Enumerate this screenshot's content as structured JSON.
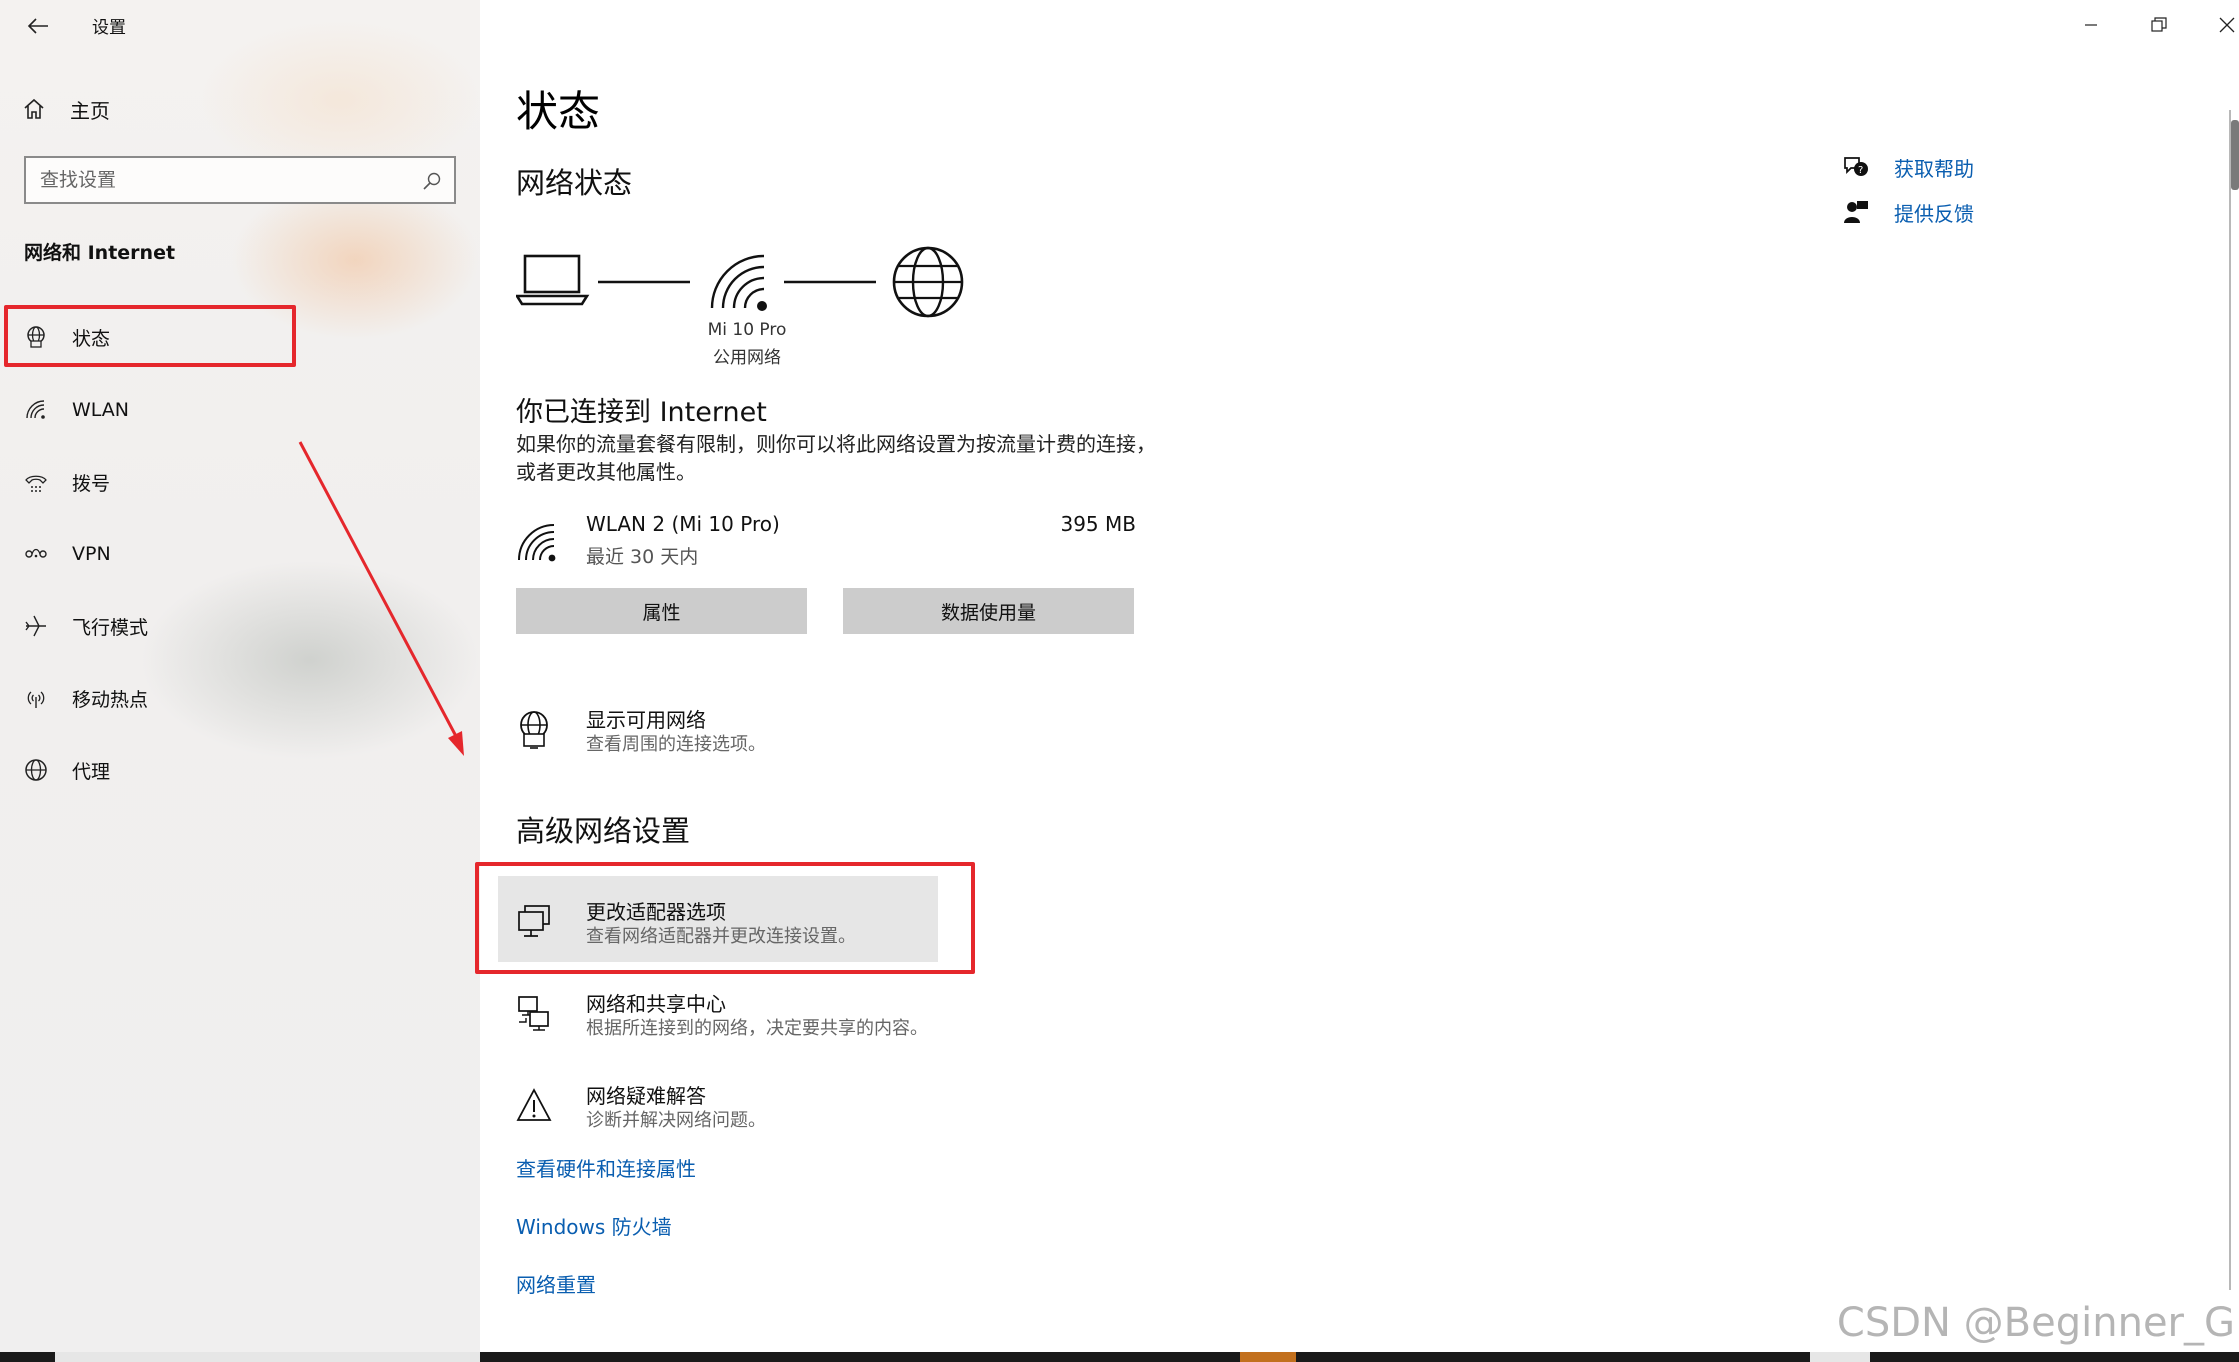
{
  "window": {
    "title": "设置",
    "minimize_icon": "minimize-icon",
    "maximize_icon": "restore-icon",
    "close_icon": "close-icon"
  },
  "sidebar": {
    "home_label": "主页",
    "search_placeholder": "查找设置",
    "section_title": "网络和 Internet",
    "items": [
      {
        "label": "状态",
        "icon": "globe-status-icon",
        "selected": true
      },
      {
        "label": "WLAN",
        "icon": "wifi-icon"
      },
      {
        "label": "拨号",
        "icon": "dialup-icon"
      },
      {
        "label": "VPN",
        "icon": "vpn-icon"
      },
      {
        "label": "飞行模式",
        "icon": "airplane-icon"
      },
      {
        "label": "移动热点",
        "icon": "hotspot-icon"
      },
      {
        "label": "代理",
        "icon": "globe-icon"
      }
    ]
  },
  "main": {
    "title": "状态",
    "network_status_title": "网络状态",
    "network_name": "Mi 10 Pro",
    "network_type": "公用网络",
    "connected_title": "你已连接到 Internet",
    "connected_desc": "如果你的流量套餐有限制，则你可以将此网络设置为按流量计费的连接，或者更改其他属性。",
    "adapter": {
      "name": "WLAN 2 (Mi 10 Pro)",
      "period": "最近 30 天内",
      "usage": "395 MB"
    },
    "buttons": {
      "properties": "属性",
      "data_usage": "数据使用量"
    },
    "show_networks": {
      "title": "显示可用网络",
      "desc": "查看周围的连接选项。"
    },
    "advanced_title": "高级网络设置",
    "advanced_items": [
      {
        "title": "更改适配器选项",
        "desc": "查看网络适配器并更改连接设置。",
        "icon": "adapter-icon"
      },
      {
        "title": "网络和共享中心",
        "desc": "根据所连接到的网络，决定要共享的内容。",
        "icon": "sharing-center-icon"
      },
      {
        "title": "网络疑难解答",
        "desc": "诊断并解决网络问题。",
        "icon": "warning-icon"
      }
    ],
    "links": {
      "hardware": "查看硬件和连接属性",
      "firewall": "Windows 防火墙",
      "reset": "网络重置"
    },
    "help": {
      "get_help": "获取帮助",
      "feedback": "提供反馈"
    }
  },
  "annotations": {
    "highlight_color": "#e5272c",
    "link_color": "#0a5eb0"
  },
  "watermark": "CSDN @Beginner_G"
}
